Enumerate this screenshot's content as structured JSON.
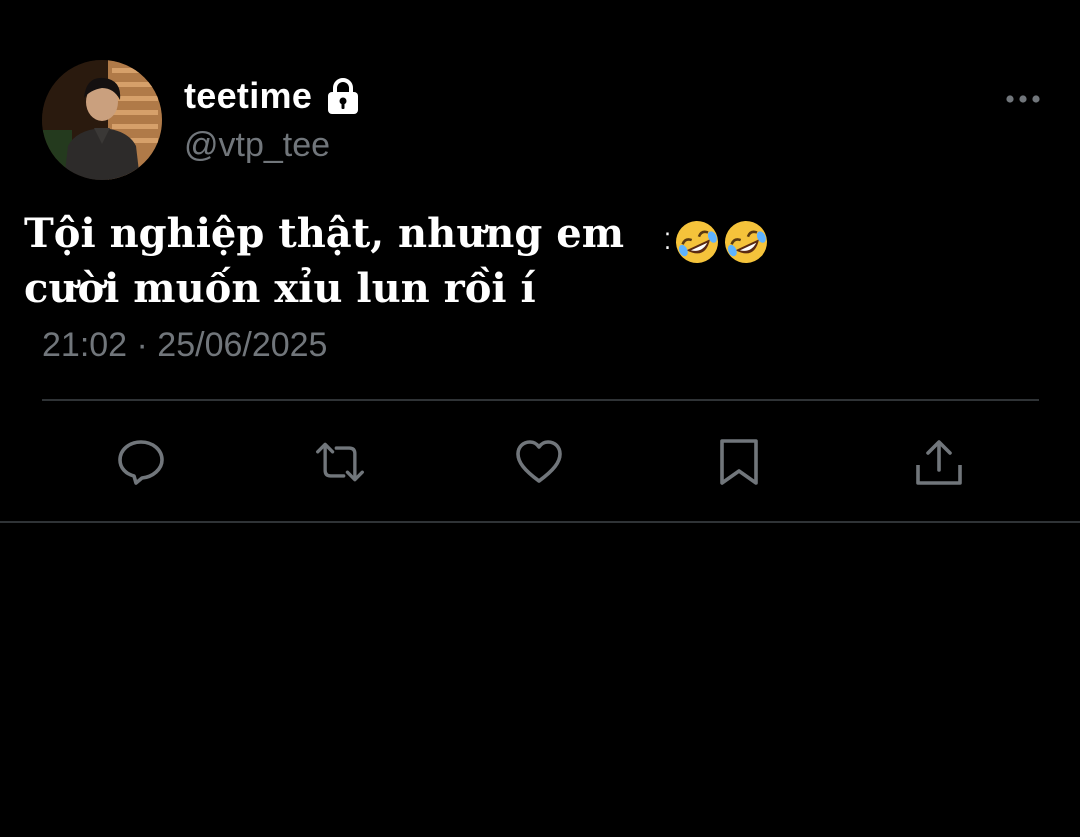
{
  "author": {
    "display_name": "teetime",
    "handle": "@vtp_tee",
    "avatar_icon": "profile-photo",
    "locked_icon": "lock-icon"
  },
  "tweet": {
    "text_line_1": "Tội nghiệp thật, nhưng em",
    "text_line_2": "cười muốn xỉu lun rồi í",
    "emoji": [
      "rolling-on-floor-laughing",
      "rolling-on-floor-laughing"
    ],
    "timestamp": "21:02 · 25/06/2025"
  },
  "actions": [
    {
      "name": "reply",
      "icon": "speech-bubble-icon"
    },
    {
      "name": "retweet",
      "icon": "retweet-arrows-icon"
    },
    {
      "name": "like",
      "icon": "heart-icon"
    },
    {
      "name": "bookmark",
      "icon": "bookmark-icon"
    },
    {
      "name": "share",
      "icon": "share-icon"
    }
  ],
  "colors": {
    "background": "#000000",
    "text_primary": "#ffffff",
    "text_secondary": "#71767b",
    "divider": "#2f3336",
    "icon": "#71767b"
  }
}
